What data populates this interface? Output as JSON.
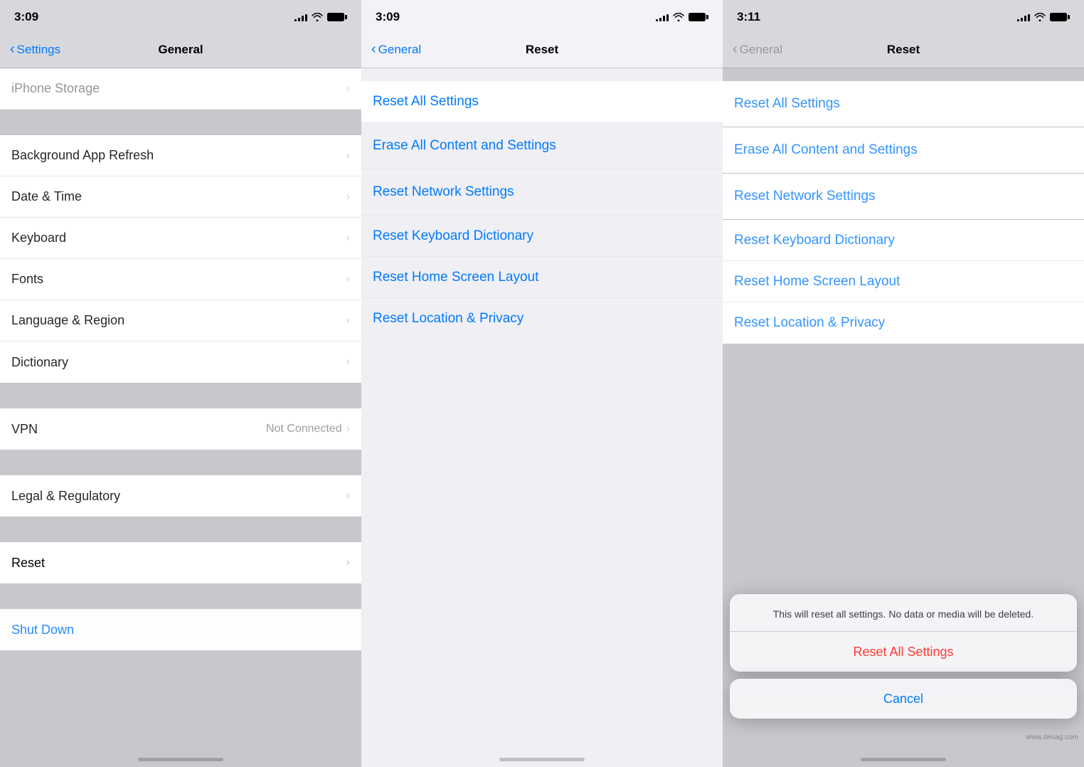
{
  "panels": [
    {
      "id": "panel-1",
      "time": "3:09",
      "nav": {
        "back_label": "Settings",
        "title": "General"
      },
      "top_partial": "iPhone Storage",
      "sections": [
        {
          "items": [
            {
              "id": "background-app-refresh",
              "label": "Background App Refresh",
              "chevron": true,
              "value": ""
            },
            {
              "id": "date-time",
              "label": "Date & Time",
              "chevron": true,
              "value": ""
            },
            {
              "id": "keyboard",
              "label": "Keyboard",
              "chevron": true,
              "value": ""
            },
            {
              "id": "fonts",
              "label": "Fonts",
              "chevron": true,
              "value": ""
            },
            {
              "id": "language-region",
              "label": "Language & Region",
              "chevron": true,
              "value": ""
            },
            {
              "id": "dictionary",
              "label": "Dictionary",
              "chevron": true,
              "value": ""
            }
          ]
        },
        {
          "items": [
            {
              "id": "vpn",
              "label": "VPN",
              "chevron": true,
              "value": "Not Connected"
            }
          ]
        },
        {
          "items": [
            {
              "id": "legal-regulatory",
              "label": "Legal & Regulatory",
              "chevron": true,
              "value": ""
            }
          ]
        },
        {
          "items": [
            {
              "id": "reset",
              "label": "Reset",
              "chevron": true,
              "value": "",
              "highlighted": true
            }
          ]
        },
        {
          "items": [
            {
              "id": "shut-down",
              "label": "Shut Down",
              "chevron": false,
              "value": "",
              "blue": true
            }
          ]
        }
      ]
    },
    {
      "id": "panel-2",
      "time": "3:09",
      "nav": {
        "back_label": "General",
        "title": "Reset"
      },
      "sections": [
        {
          "items": [
            {
              "id": "reset-all-settings",
              "label": "Reset All Settings",
              "chevron": false,
              "blue": true,
              "highlighted": true
            }
          ]
        },
        {
          "items": [
            {
              "id": "erase-all-content",
              "label": "Erase All Content and Settings",
              "chevron": false,
              "blue": true
            }
          ]
        },
        {
          "items": [
            {
              "id": "reset-network",
              "label": "Reset Network Settings",
              "chevron": false,
              "blue": true
            }
          ]
        },
        {
          "items": [
            {
              "id": "reset-keyboard",
              "label": "Reset Keyboard Dictionary",
              "chevron": false,
              "blue": true
            },
            {
              "id": "reset-home-screen",
              "label": "Reset Home Screen Layout",
              "chevron": false,
              "blue": true
            },
            {
              "id": "reset-location",
              "label": "Reset Location & Privacy",
              "chevron": false,
              "blue": true
            }
          ]
        }
      ]
    },
    {
      "id": "panel-3",
      "time": "3:11",
      "nav": {
        "back_label": "General",
        "title": "Reset"
      },
      "sections": [
        {
          "items": [
            {
              "id": "reset-all-settings-3",
              "label": "Reset All Settings",
              "chevron": false,
              "blue": true
            }
          ]
        },
        {
          "items": [
            {
              "id": "erase-all-content-3",
              "label": "Erase All Content and Settings",
              "chevron": false,
              "blue": true
            }
          ]
        },
        {
          "items": [
            {
              "id": "reset-network-3",
              "label": "Reset Network Settings",
              "chevron": false,
              "blue": true
            }
          ]
        },
        {
          "items": [
            {
              "id": "reset-keyboard-3",
              "label": "Reset Keyboard Dictionary",
              "chevron": false,
              "blue": true
            },
            {
              "id": "reset-home-screen-3",
              "label": "Reset Home Screen Layout",
              "chevron": false,
              "blue": true
            },
            {
              "id": "reset-location-3",
              "label": "Reset Location & Privacy",
              "chevron": false,
              "blue": true
            }
          ]
        }
      ],
      "alert": {
        "message": "This will reset all settings. No data or media will be deleted.",
        "confirm_label": "Reset All Settings",
        "cancel_label": "Cancel"
      }
    }
  ],
  "watermark": "www.deuag.com"
}
